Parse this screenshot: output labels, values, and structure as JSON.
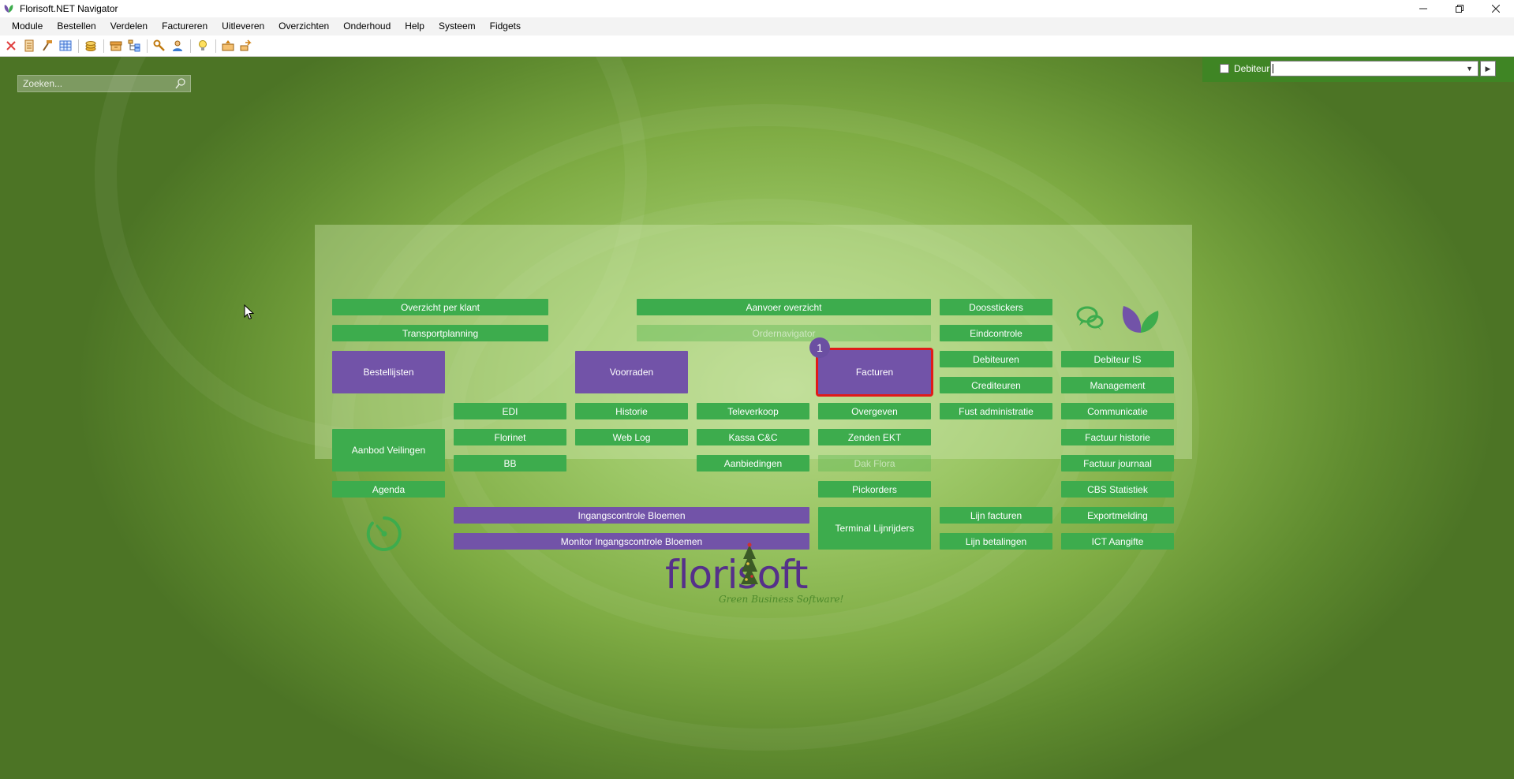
{
  "window": {
    "title": "Florisoft.NET Navigator",
    "minimize_icon": "minimize-icon",
    "restore_icon": "restore-icon",
    "close_icon": "close-icon"
  },
  "menu": [
    "Module",
    "Bestellen",
    "Verdelen",
    "Factureren",
    "Uitleveren",
    "Overzichten",
    "Onderhoud",
    "Help",
    "Systeem",
    "Fidgets"
  ],
  "toolbar_icons": [
    "close-icon",
    "document-icon",
    "hammer-icon",
    "grid-icon",
    "coins-icon",
    "archive-icon",
    "tree-icon",
    "wrench-icon",
    "user-icon",
    "lightbulb-icon",
    "transfer-icon",
    "export-icon"
  ],
  "search": {
    "placeholder": "Zoeken..."
  },
  "debiteur": {
    "label": "Debiteur",
    "value": ""
  },
  "tiles": {
    "overzicht_per_klant": "Overzicht per klant",
    "aanvoer_overzicht": "Aanvoer overzicht",
    "doosstickers": "Doosstickers",
    "transportplanning": "Transportplanning",
    "ordernavigator": "Ordernavigator",
    "eindcontrole": "Eindcontrole",
    "bestellijsten": "Bestellijsten",
    "voorraden": "Voorraden",
    "facturen": "Facturen",
    "debiteuren": "Debiteuren",
    "debiteur_is": "Debiteur IS",
    "crediteuren": "Crediteuren",
    "management": "Management",
    "edi": "EDI",
    "historie": "Historie",
    "televerkoop": "Televerkoop",
    "overgeven": "Overgeven",
    "fust_administratie": "Fust administratie",
    "communicatie": "Communicatie",
    "aanbod_veilingen": "Aanbod Veilingen",
    "florinet": "Florinet",
    "web_log": "Web Log",
    "kassa_cc": "Kassa C&C",
    "zenden_ekt": "Zenden EKT",
    "factuur_historie": "Factuur historie",
    "bb": "BB",
    "aanbiedingen": "Aanbiedingen",
    "dak_flora": "Dak Flora",
    "factuur_journaal": "Factuur journaal",
    "agenda": "Agenda",
    "pickorders": "Pickorders",
    "cbs_statistiek": "CBS Statistiek",
    "ingangscontrole_bloemen": "Ingangscontrole Bloemen",
    "terminal_lijnrijders": "Terminal Lijnrijders",
    "lijn_facturen": "Lijn facturen",
    "exportmelding": "Exportmelding",
    "monitor_ingangscontrole_bloemen": "Monitor Ingangscontrole Bloemen",
    "lijn_betalingen": "Lijn betalingen",
    "ict_aangifte": "ICT Aangifte"
  },
  "badge": "1",
  "icons": {
    "chat": "chat-bubbles-icon",
    "leaf": "leaf-logo-icon",
    "timer": "timer-icon",
    "cursor": "mouse-cursor-icon"
  },
  "logo": {
    "text": "florisoft",
    "tagline": "Green Business Software!"
  },
  "colors": {
    "tile_green": "#3dac4d",
    "tile_purple": "#7253a8",
    "selection": "#e01a1a",
    "logo_purple": "#55308a"
  }
}
